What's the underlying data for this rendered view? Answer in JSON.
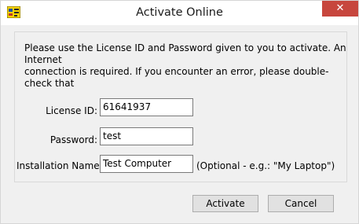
{
  "window": {
    "title": "Activate Online",
    "close_glyph": "✕"
  },
  "message": "Please use the License ID and Password given to you to activate.  An Internet\nconnection is required.  If you encounter an error, please double-check that\nthe License ID and Password are correct, and temporarily disable any\npersonal firewalls you may have installed.",
  "form": {
    "license_id": {
      "label": "License ID:",
      "value": "61641937"
    },
    "password": {
      "label": "Password:",
      "value": "test"
    },
    "installation_name": {
      "label": "Installation Name:",
      "value": "Test Computer",
      "hint": "(Optional - e.g.: \"My Laptop\")"
    }
  },
  "buttons": {
    "activate": "Activate",
    "cancel": "Cancel"
  },
  "colors": {
    "close_button": "#c7463d",
    "titlebar": "#ffffff",
    "dialog_bg": "#f0f0f0"
  },
  "icons": {
    "app_icon": "labview-app-icon",
    "close_icon": "close-icon"
  }
}
